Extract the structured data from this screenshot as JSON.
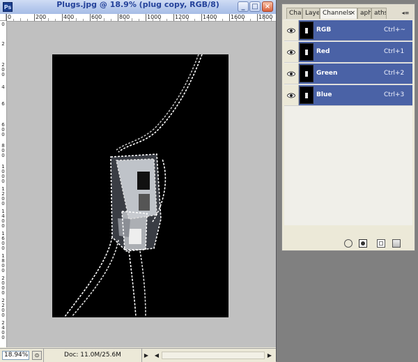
{
  "document_window": {
    "title": "Plugs.jpg @ 18.9% (plug copy, RGB/8)",
    "app_icon_text": "Ps",
    "controls": {
      "minimize": "_",
      "maximize": "□",
      "close": "×"
    },
    "ruler_top_labels": [
      "0",
      "200",
      "400",
      "600",
      "800",
      "1000",
      "1200",
      "1400",
      "1600",
      "1800"
    ],
    "ruler_left_labels": [
      "0",
      "2",
      "200",
      "4",
      "6",
      "600",
      "800",
      "1000",
      "1200",
      "1400",
      "1600",
      "1800",
      "2000",
      "2200",
      "2400"
    ],
    "canvas_background": "#c0c0c0",
    "image_background": "#000000",
    "status": {
      "zoom": "18.94%",
      "doc_info": "Doc: 11.0M/25.6M",
      "nav_right_glyph": "▶",
      "nav_left_glyph": "◀"
    }
  },
  "channels_panel": {
    "tabs": [
      "Char",
      "Laye",
      "Channels",
      "aph",
      "aths"
    ],
    "active_tab": "Channels",
    "tab_close_glyph": "×",
    "menu_glyph": "◂≡",
    "selected_color": "#4a62a6",
    "channels": [
      {
        "name": "RGB",
        "shortcut": "Ctrl+~"
      },
      {
        "name": "Red",
        "shortcut": "Ctrl+1"
      },
      {
        "name": "Green",
        "shortcut": "Ctrl+2"
      },
      {
        "name": "Blue",
        "shortcut": "Ctrl+3"
      }
    ],
    "footer_icons": [
      "load-selection-icon",
      "save-selection-icon",
      "new-channel-icon",
      "trash-icon"
    ]
  }
}
